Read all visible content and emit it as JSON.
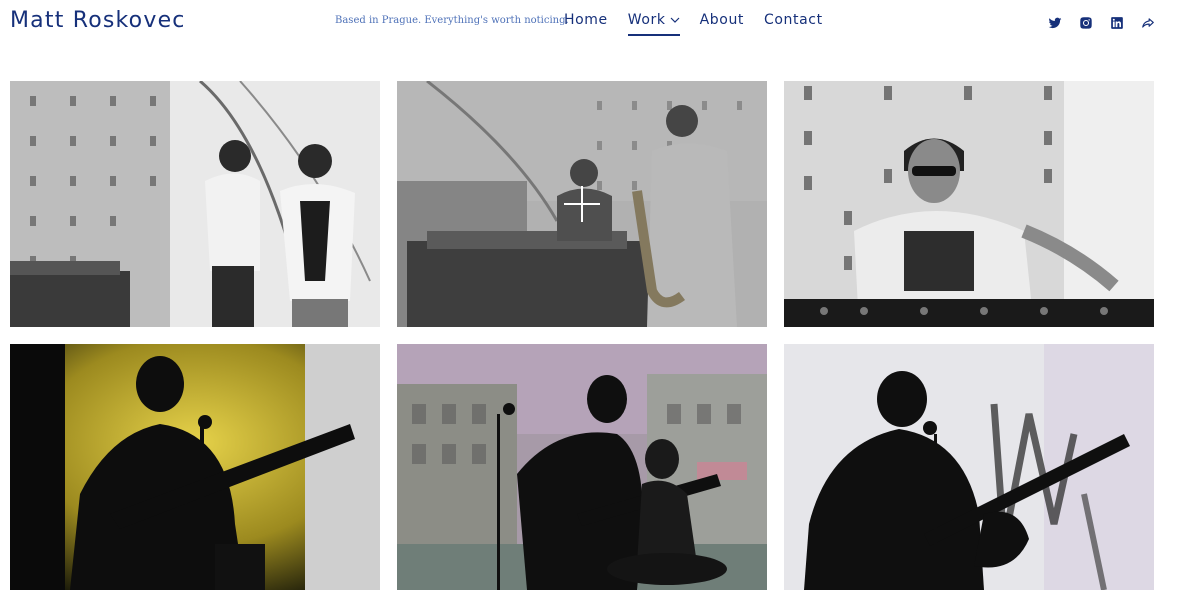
{
  "header": {
    "site_title": "Matt Roskovec",
    "tagline": "Based in Prague. Everything's worth noticing.",
    "nav": [
      {
        "label": "Home",
        "active": false,
        "has_dropdown": false
      },
      {
        "label": "Work",
        "active": true,
        "has_dropdown": true
      },
      {
        "label": "About",
        "active": false,
        "has_dropdown": false
      },
      {
        "label": "Contact",
        "active": false,
        "has_dropdown": false
      }
    ],
    "social_icons": [
      "twitter-icon",
      "instagram-icon",
      "linkedin-icon",
      "share-icon"
    ]
  },
  "gallery": {
    "tiles": [
      {
        "icon": "photo-djs-on-stage-bw",
        "hovered": false
      },
      {
        "icon": "photo-dj-and-saxophonist-bw",
        "hovered": true
      },
      {
        "icon": "photo-dj-with-headphones-bw",
        "hovered": false
      },
      {
        "icon": "photo-guitarist-silhouette-yellow",
        "hovered": false
      },
      {
        "icon": "photo-band-silhouette-street",
        "hovered": false
      },
      {
        "icon": "photo-bassist-silhouette-light",
        "hovered": false
      }
    ]
  },
  "colors": {
    "brand": "#16307a",
    "tagline": "#4f72b8",
    "background": "#ffffff"
  }
}
